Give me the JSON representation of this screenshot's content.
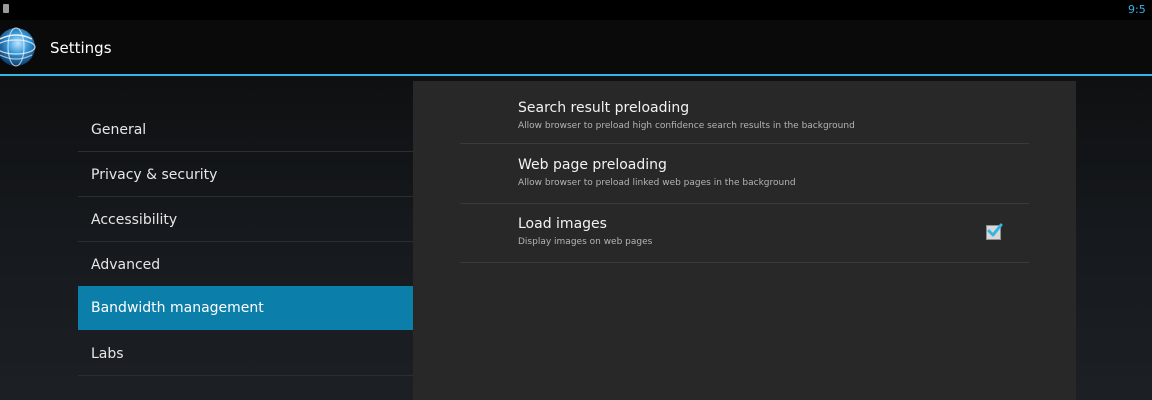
{
  "status_bar": {
    "clock": "9:5"
  },
  "action_bar": {
    "title": "Settings",
    "accent_color": "#33b5e5"
  },
  "sidebar": {
    "items": [
      {
        "label": "General"
      },
      {
        "label": "Privacy & security"
      },
      {
        "label": "Accessibility"
      },
      {
        "label": "Advanced"
      },
      {
        "label": "Bandwidth management"
      },
      {
        "label": "Labs"
      }
    ],
    "selected_color": "#0b7faa"
  },
  "bandwidth": {
    "preferences": [
      {
        "title": "Search result preloading",
        "summary": "Allow browser to preload high confidence search results in the background"
      },
      {
        "title": "Web page preloading",
        "summary": "Allow browser to preload linked web pages in the background"
      },
      {
        "title": "Load images",
        "summary": "Display images on web pages",
        "checked": true
      }
    ]
  }
}
